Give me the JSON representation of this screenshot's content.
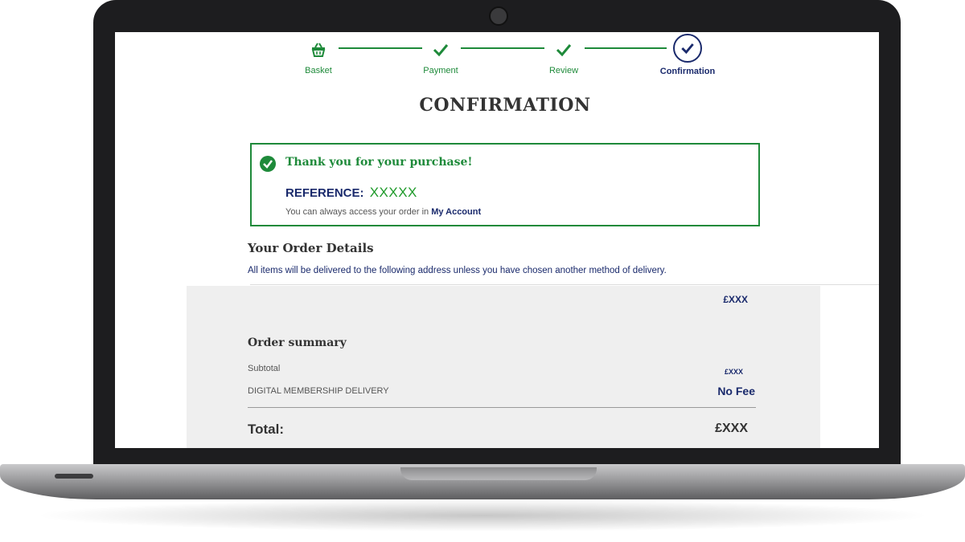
{
  "stepper": {
    "steps": [
      {
        "label": "Basket",
        "icon": "basket-icon"
      },
      {
        "label": "Payment",
        "icon": "check-icon"
      },
      {
        "label": "Review",
        "icon": "check-icon"
      },
      {
        "label": "Confirmation",
        "icon": "check-circle-icon"
      }
    ]
  },
  "page": {
    "title": "CONFIRMATION"
  },
  "confirmation": {
    "thanks": "Thank you for your purchase!",
    "reference_label": "REFERENCE:",
    "reference_value": "XXXXX",
    "access_text": "You can always access your order in",
    "access_link": "My Account"
  },
  "order_details": {
    "heading": "Your Order Details",
    "note": "All items will be delivered to the following address unless you have chosen another method of delivery."
  },
  "summary": {
    "item_price": "£XXX",
    "heading": "Order summary",
    "subtotal_label": "Subtotal",
    "subtotal_value": "£XXX",
    "delivery_label": "DIGITAL MEMBERSHIP DELIVERY",
    "delivery_value": "No Fee",
    "total_label": "Total:",
    "total_value": "£XXX"
  },
  "colors": {
    "accent_green": "#1e8a3a",
    "navy": "#1a2a6c",
    "summary_bg": "#efefef"
  }
}
